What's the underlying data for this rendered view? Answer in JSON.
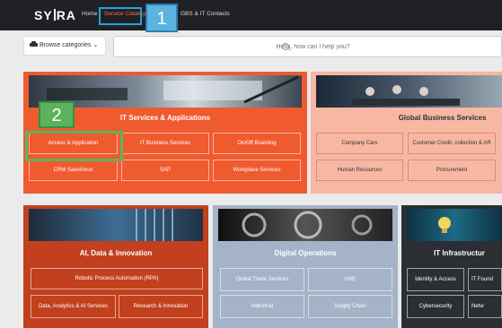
{
  "header": {
    "logo_left": "SY",
    "logo_right": "RA",
    "nav": [
      "Home",
      "Service Catalog",
      "GBS & IT Contacts"
    ]
  },
  "badges": {
    "step1": "1",
    "step2": "2"
  },
  "toolbar": {
    "browse_label": "Browse categories"
  },
  "search": {
    "placeholder": "Hello, how can I help you?"
  },
  "cards": {
    "it_services": {
      "title": "IT Services & Applications",
      "tiles": [
        "Access & Application",
        "IT Business Services",
        "On/Off Boarding",
        "CRM Salesforce",
        "SAP",
        "Workplace Services"
      ]
    },
    "gbs": {
      "title": "Global Business Services",
      "tiles": [
        "Company Cars",
        "Customer Credit, collection & AR",
        "Human Resources",
        "Procurement"
      ]
    },
    "ai": {
      "title": "AI, Data & Innovation",
      "tiles": [
        "Robotic Process Automation (RPA)",
        "Data, Analytics & AI Services",
        "Research & Innovation"
      ]
    },
    "digital": {
      "title": "Digital Operations",
      "tiles": [
        "Global Trade Services",
        "HSE",
        "Industrial",
        "Supply Chain"
      ]
    },
    "infra": {
      "title": "IT Infrastructur",
      "tiles": [
        "Identity & Access",
        "IT Found",
        "Cybersecurity",
        "Netw"
      ]
    }
  },
  "colors": {
    "topbar": "#202124",
    "orange": "#f05a2f",
    "salmon": "#f7b7a3",
    "rust": "#c2401e",
    "slate": "#a4b3c7",
    "charcoal": "#2b2e33",
    "highlight_blue": "#1ea6dd",
    "highlight_green": "#5cb35d"
  }
}
